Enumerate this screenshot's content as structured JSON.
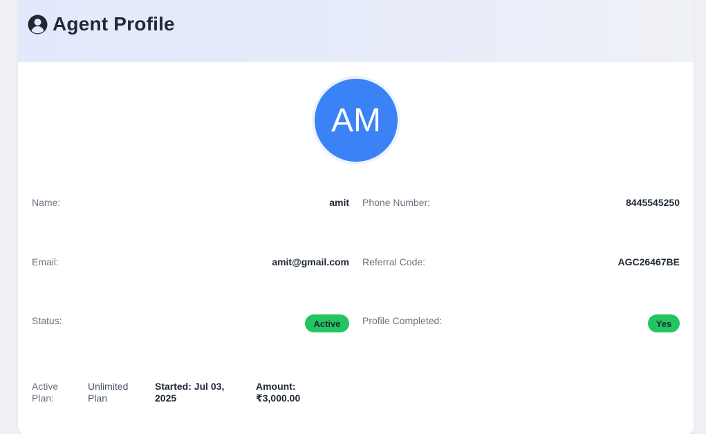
{
  "header": {
    "title": "Agent Profile",
    "icon": "user-circle-icon"
  },
  "avatar": {
    "initials": "AM",
    "color": "#3b82f6"
  },
  "fields": {
    "name": {
      "label": "Name:",
      "value": "amit"
    },
    "phone": {
      "label": "Phone Number:",
      "value": "8445545250"
    },
    "email": {
      "label": "Email:",
      "value": "amit@gmail.com"
    },
    "referral": {
      "label": "Referral Code:",
      "value": "AGC26467BE"
    },
    "status": {
      "label": "Status:",
      "value": "Active"
    },
    "profile_completed": {
      "label": "Profile Completed:",
      "value": "Yes"
    }
  },
  "plan": {
    "label_line1": "Active",
    "label_line2": "Plan:",
    "name_line1": "Unlimited",
    "name_line2": "Plan",
    "started_line1": "Started: Jul 03,",
    "started_line2": "2025",
    "amount_line1": "Amount:",
    "amount_line2": "₹3,000.00"
  },
  "colors": {
    "badge_green": "#22c55e",
    "header_bg": "#e2e9fc"
  }
}
